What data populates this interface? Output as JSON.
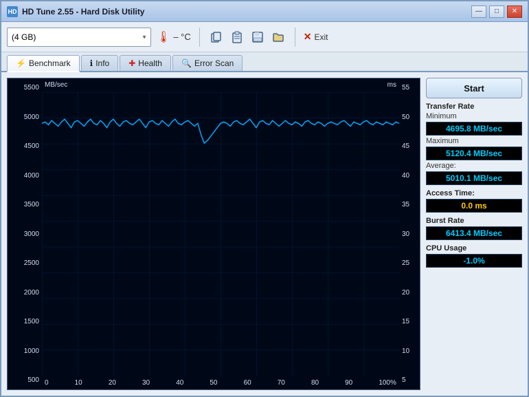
{
  "window": {
    "title": "HD Tune 2.55 - Hard Disk Utility",
    "icon": "HD"
  },
  "toolbar": {
    "drive_select_value": "(4 GB)",
    "drive_options": [
      "(4 GB)"
    ],
    "temp_display": "– °C",
    "exit_label": "Exit"
  },
  "tabs": [
    {
      "id": "benchmark",
      "label": "Benchmark",
      "icon": "⚡",
      "active": true
    },
    {
      "id": "info",
      "label": "Info",
      "icon": "ℹ"
    },
    {
      "id": "health",
      "label": "Health",
      "icon": "✚"
    },
    {
      "id": "error-scan",
      "label": "Error Scan",
      "icon": "🔍"
    }
  ],
  "chart": {
    "y_left_label": "MB/sec",
    "y_right_label": "ms",
    "y_left_values": [
      "5500",
      "5000",
      "4500",
      "4000",
      "3500",
      "3000",
      "2500",
      "2000",
      "1500",
      "1000",
      "500"
    ],
    "y_right_values": [
      "55",
      "50",
      "45",
      "40",
      "35",
      "30",
      "25",
      "20",
      "15",
      "10",
      "5"
    ],
    "x_values": [
      "0",
      "10",
      "20",
      "30",
      "40",
      "50",
      "60",
      "70",
      "80",
      "90",
      "100%"
    ]
  },
  "sidebar": {
    "start_label": "Start",
    "transfer_rate_label": "Transfer Rate",
    "minimum_label": "Minimum",
    "minimum_value": "4695.8 MB/sec",
    "maximum_label": "Maximum",
    "maximum_value": "5120.4 MB/sec",
    "average_label": "Average:",
    "average_value": "5010.1 MB/sec",
    "access_time_label": "Access Time:",
    "access_time_value": "0.0 ms",
    "burst_rate_label": "Burst Rate",
    "burst_rate_value": "6413.4 MB/sec",
    "cpu_usage_label": "CPU Usage",
    "cpu_usage_value": "-1.0%"
  },
  "colors": {
    "accent_blue": "#00ccff",
    "accent_yellow": "#ffcc00",
    "chart_line": "#00aaff",
    "chart_bg": "#000818",
    "grid_line": "#003366"
  }
}
